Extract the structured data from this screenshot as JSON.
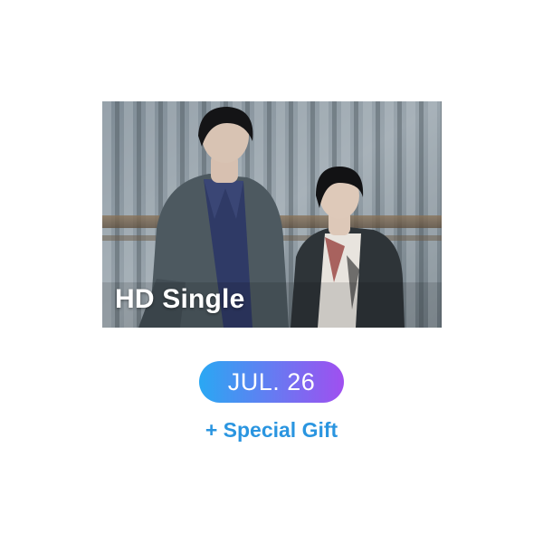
{
  "photo": {
    "label": "HD Single",
    "image": "two-men-in-suits-against-corrugated-metal-wall"
  },
  "release": {
    "date": "JUL. 26"
  },
  "bonus": {
    "text": "+ Special Gift"
  },
  "colors": {
    "pill_gradient_start": "#2aa8f3",
    "pill_gradient_end": "#a04ff0",
    "gift_text": "#2a95e0",
    "label_text": "#ffffff",
    "background": "#ffffff"
  }
}
